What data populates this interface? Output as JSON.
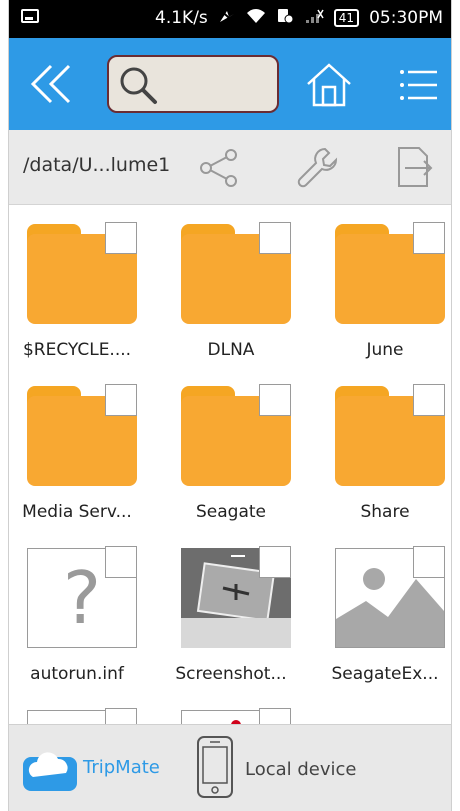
{
  "status_bar": {
    "speed": "4.1K/s",
    "battery": "41",
    "time": "05:30PM"
  },
  "search": {
    "placeholder": ""
  },
  "path_bar": {
    "path": "/data/U...lume1"
  },
  "files": [
    {
      "name": "$RECYCLE....",
      "type": "folder"
    },
    {
      "name": "DLNA",
      "type": "folder"
    },
    {
      "name": "June",
      "type": "folder"
    },
    {
      "name": "Media Serv...",
      "type": "folder"
    },
    {
      "name": "Seagate",
      "type": "folder"
    },
    {
      "name": "Share",
      "type": "folder"
    },
    {
      "name": "autorun.inf",
      "type": "unknown"
    },
    {
      "name": "Screenshot...",
      "type": "photo"
    },
    {
      "name": "SeagateEx...",
      "type": "image"
    }
  ],
  "bottom_tabs": [
    {
      "label": "TripMate",
      "icon": "cloud-drive-icon",
      "active": true
    },
    {
      "label": "Local device",
      "icon": "phone-icon",
      "active": false
    }
  ],
  "colors": {
    "accent": "#2e9ae6",
    "folder": "#f8a832"
  }
}
